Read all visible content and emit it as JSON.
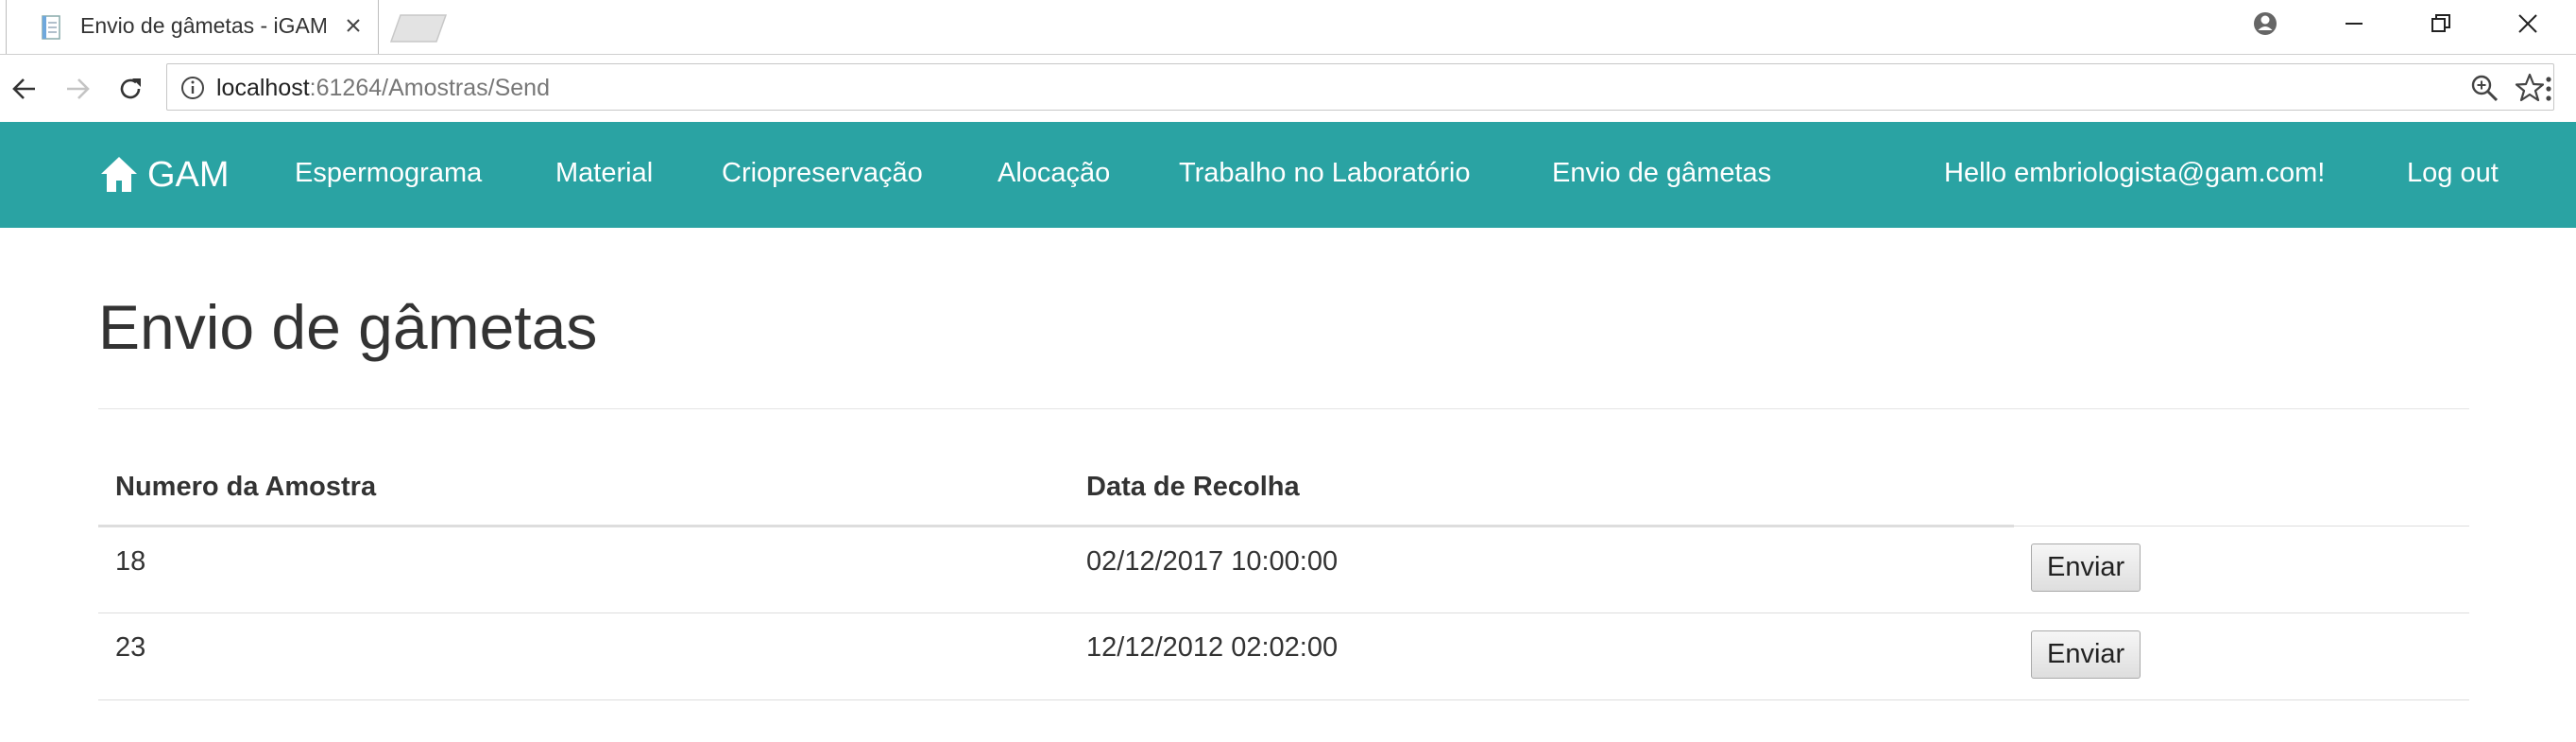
{
  "browser": {
    "tab_title": "Envio de gâmetas - iGAM",
    "url_host": "localhost",
    "url_rest": ":61264/Amostras/Send"
  },
  "navbar": {
    "brand": "GAM",
    "links": [
      "Espermograma",
      "Material",
      "Criopreservação",
      "Alocação",
      "Trabalho no Laboratório",
      "Envio de gâmetas"
    ],
    "greeting": "Hello embriologista@gam.com!",
    "logout": "Log out",
    "color": "#2aa3a3"
  },
  "page": {
    "title": "Envio de gâmetas"
  },
  "table": {
    "headers": [
      "Numero da Amostra",
      "Data de Recolha",
      ""
    ],
    "rows": [
      {
        "numero": "18",
        "data": "02/12/2017 10:00:00",
        "action": "Enviar"
      },
      {
        "numero": "23",
        "data": "12/12/2012 02:02:00",
        "action": "Enviar"
      }
    ]
  }
}
